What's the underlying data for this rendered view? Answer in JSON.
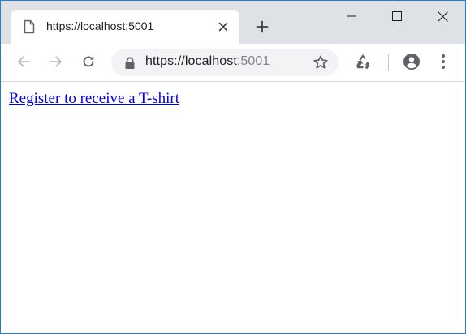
{
  "tab": {
    "title": "https://localhost:5001",
    "icon": "document-icon",
    "close_icon": "close-icon"
  },
  "new_tab_icon": "plus-icon",
  "window_controls": [
    "minimize-icon",
    "maximize-icon",
    "close-icon"
  ],
  "toolbar": {
    "back_icon": "arrow-left-icon",
    "forward_icon": "arrow-right-icon",
    "reload_icon": "reload-icon",
    "extension_icon": "recycle-icon",
    "profile_icon": "account-icon",
    "menu_icon": "more-vert-icon"
  },
  "omnibox": {
    "lock_icon": "lock-icon",
    "url_host": "https://localhost",
    "url_port": ":5001",
    "star_icon": "star-icon"
  },
  "page": {
    "link_text": "Register to receive a T-shirt"
  },
  "colors": {
    "accent_border": "#1e7fd4",
    "tabstrip": "#dee1e6",
    "omnibox": "#f1f3f4",
    "link": "#0000ee"
  }
}
